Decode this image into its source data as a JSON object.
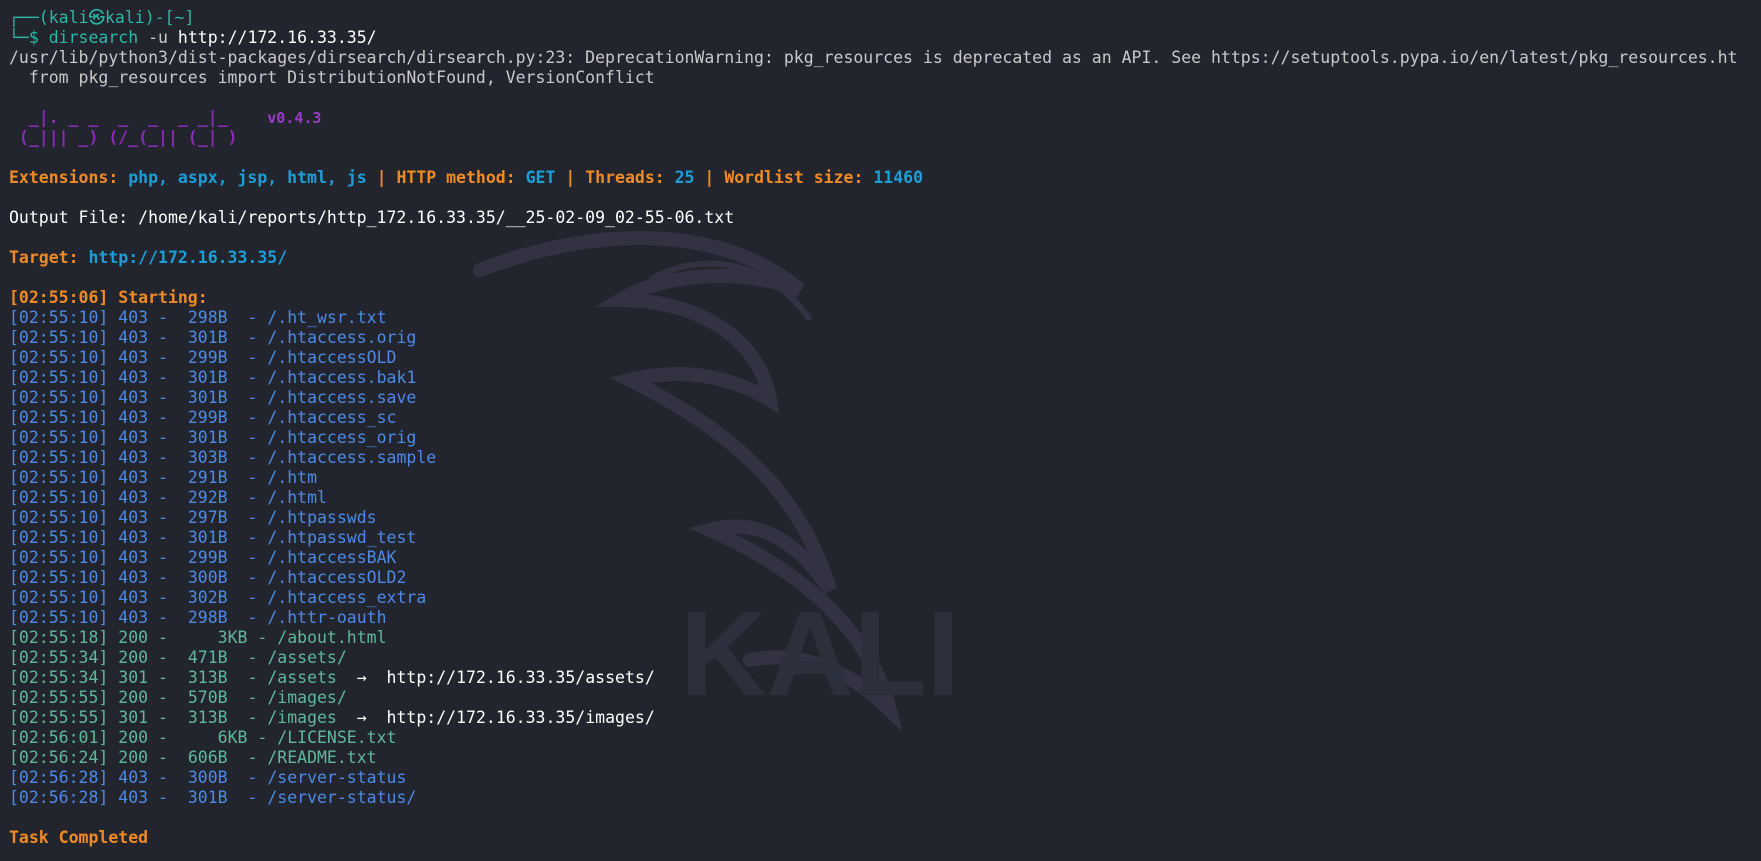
{
  "prompt": {
    "line1": "┌──(kali㉿kali)-[~]",
    "dollar": "└─$",
    "cmd": "dirsearch",
    "flag": " -u",
    "url": " http://172.16.33.35/"
  },
  "warning": {
    "line1": "/usr/lib/python3/dist-packages/dirsearch/dirsearch.py:23: DeprecationWarning: pkg_resources is deprecated as an API. See https://setuptools.pypa.io/en/latest/pkg_resources.ht",
    "line2": "  from pkg_resources import DistributionNotFound, VersionConflict"
  },
  "banner": {
    "line1": "  _|. _ _  _  _  _ _|_    v0.4.3",
    "line2": " (_||| _) (/_(_|| (_| )"
  },
  "config": {
    "ext_label": "Extensions: ",
    "ext_value": "php, aspx, jsp, html, js",
    "sep": " | ",
    "method_label": "HTTP method: ",
    "method_value": "GET",
    "threads_label": "Threads: ",
    "threads_value": "25",
    "wordlist_label": "Wordlist size: ",
    "wordlist_value": "11460"
  },
  "output_file": "Output File: /home/kali/reports/http_172.16.33.35/__25-02-09_02-55-06.txt",
  "target": {
    "label": "Target: ",
    "value": "http://172.16.33.35/"
  },
  "starting": "[02:55:06] Starting: ",
  "results": [
    {
      "time": "[02:55:10]",
      "code": "403",
      "size": "298B ",
      "path": "/.ht_wsr.txt",
      "redirect": ""
    },
    {
      "time": "[02:55:10]",
      "code": "403",
      "size": "301B ",
      "path": "/.htaccess.orig",
      "redirect": ""
    },
    {
      "time": "[02:55:10]",
      "code": "403",
      "size": "299B ",
      "path": "/.htaccessOLD",
      "redirect": ""
    },
    {
      "time": "[02:55:10]",
      "code": "403",
      "size": "301B ",
      "path": "/.htaccess.bak1",
      "redirect": ""
    },
    {
      "time": "[02:55:10]",
      "code": "403",
      "size": "301B ",
      "path": "/.htaccess.save",
      "redirect": ""
    },
    {
      "time": "[02:55:10]",
      "code": "403",
      "size": "299B ",
      "path": "/.htaccess_sc",
      "redirect": ""
    },
    {
      "time": "[02:55:10]",
      "code": "403",
      "size": "301B ",
      "path": "/.htaccess_orig",
      "redirect": ""
    },
    {
      "time": "[02:55:10]",
      "code": "403",
      "size": "303B ",
      "path": "/.htaccess.sample",
      "redirect": ""
    },
    {
      "time": "[02:55:10]",
      "code": "403",
      "size": "291B ",
      "path": "/.htm",
      "redirect": ""
    },
    {
      "time": "[02:55:10]",
      "code": "403",
      "size": "292B ",
      "path": "/.html",
      "redirect": ""
    },
    {
      "time": "[02:55:10]",
      "code": "403",
      "size": "297B ",
      "path": "/.htpasswds",
      "redirect": ""
    },
    {
      "time": "[02:55:10]",
      "code": "403",
      "size": "301B ",
      "path": "/.htpasswd_test",
      "redirect": ""
    },
    {
      "time": "[02:55:10]",
      "code": "403",
      "size": "299B ",
      "path": "/.htaccessBAK",
      "redirect": ""
    },
    {
      "time": "[02:55:10]",
      "code": "403",
      "size": "300B ",
      "path": "/.htaccessOLD2",
      "redirect": ""
    },
    {
      "time": "[02:55:10]",
      "code": "403",
      "size": "302B ",
      "path": "/.htaccess_extra",
      "redirect": ""
    },
    {
      "time": "[02:55:10]",
      "code": "403",
      "size": "298B ",
      "path": "/.httr-oauth",
      "redirect": ""
    },
    {
      "time": "[02:55:18]",
      "code": "200",
      "size": "   3KB",
      "path": "/about.html",
      "redirect": ""
    },
    {
      "time": "[02:55:34]",
      "code": "200",
      "size": "471B ",
      "path": "/assets/",
      "redirect": ""
    },
    {
      "time": "[02:55:34]",
      "code": "301",
      "size": "313B ",
      "path": "/assets",
      "redirect": "http://172.16.33.35/assets/"
    },
    {
      "time": "[02:55:55]",
      "code": "200",
      "size": "570B ",
      "path": "/images/",
      "redirect": ""
    },
    {
      "time": "[02:55:55]",
      "code": "301",
      "size": "313B ",
      "path": "/images",
      "redirect": "http://172.16.33.35/images/"
    },
    {
      "time": "[02:56:01]",
      "code": "200",
      "size": "   6KB",
      "path": "/LICENSE.txt",
      "redirect": ""
    },
    {
      "time": "[02:56:24]",
      "code": "200",
      "size": "606B ",
      "path": "/README.txt",
      "redirect": ""
    },
    {
      "time": "[02:56:28]",
      "code": "403",
      "size": "300B ",
      "path": "/server-status",
      "redirect": ""
    },
    {
      "time": "[02:56:28]",
      "code": "403",
      "size": "301B ",
      "path": "/server-status/",
      "redirect": ""
    }
  ],
  "arrow": "  →  ",
  "dash": " -  ",
  "pathdash": " - ",
  "completed": "Task Completed",
  "watermark_text": "KALI",
  "colors": {
    "background": "#23252e",
    "prompt": "#2bb8a6",
    "user": "#3b8eea",
    "ok": "#5fb89a",
    "forbidden": "#4d8ae6",
    "accent": "#f08a24",
    "value": "#1a9fd8",
    "banner": "#8a2cb5"
  }
}
